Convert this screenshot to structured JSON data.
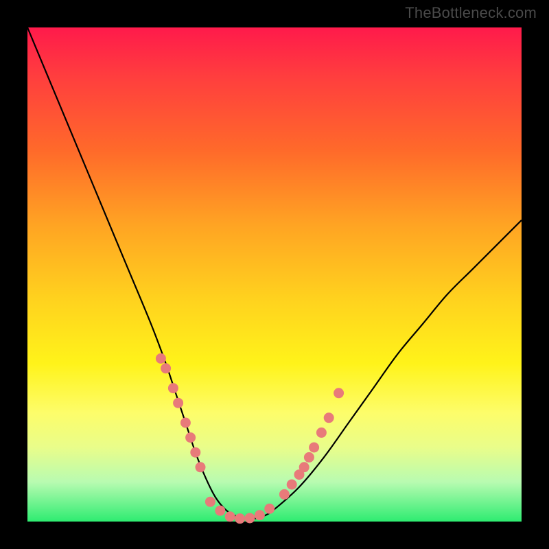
{
  "watermark": "TheBottleneck.com",
  "chart_data": {
    "type": "line",
    "title": "",
    "xlabel": "",
    "ylabel": "",
    "xlim": [
      0,
      100
    ],
    "ylim": [
      0,
      100
    ],
    "grid": false,
    "legend": false,
    "series": [
      {
        "name": "bottleneck-curve",
        "x": [
          0,
          5,
          10,
          15,
          20,
          25,
          28,
          30,
          32,
          34,
          36,
          38,
          40,
          42,
          44,
          46,
          48,
          50,
          55,
          60,
          65,
          70,
          75,
          80,
          85,
          90,
          95,
          100
        ],
        "y": [
          100,
          88,
          76,
          64,
          52,
          40,
          32,
          26,
          20,
          14,
          9,
          5,
          2.5,
          1.2,
          0.6,
          0.6,
          1.2,
          2.5,
          7,
          13,
          20,
          27,
          34,
          40,
          46,
          51,
          56,
          61
        ]
      }
    ],
    "highlight_points": {
      "name": "marker-dots",
      "color": "#e87a7a",
      "left_cluster": {
        "x": [
          27,
          28,
          29.5,
          30.5,
          32,
          33,
          34,
          35
        ],
        "y": [
          33,
          31,
          27,
          24,
          20,
          17,
          14,
          11
        ]
      },
      "bottom_cluster": {
        "x": [
          37,
          39,
          41,
          43,
          45,
          47,
          49
        ],
        "y": [
          4,
          2.2,
          1.0,
          0.6,
          0.7,
          1.3,
          2.6
        ]
      },
      "right_cluster": {
        "x": [
          52,
          53.5,
          55,
          56,
          57,
          58,
          59.5,
          61,
          63
        ],
        "y": [
          5.5,
          7.5,
          9.5,
          11,
          13,
          15,
          18,
          21,
          26
        ]
      }
    }
  }
}
